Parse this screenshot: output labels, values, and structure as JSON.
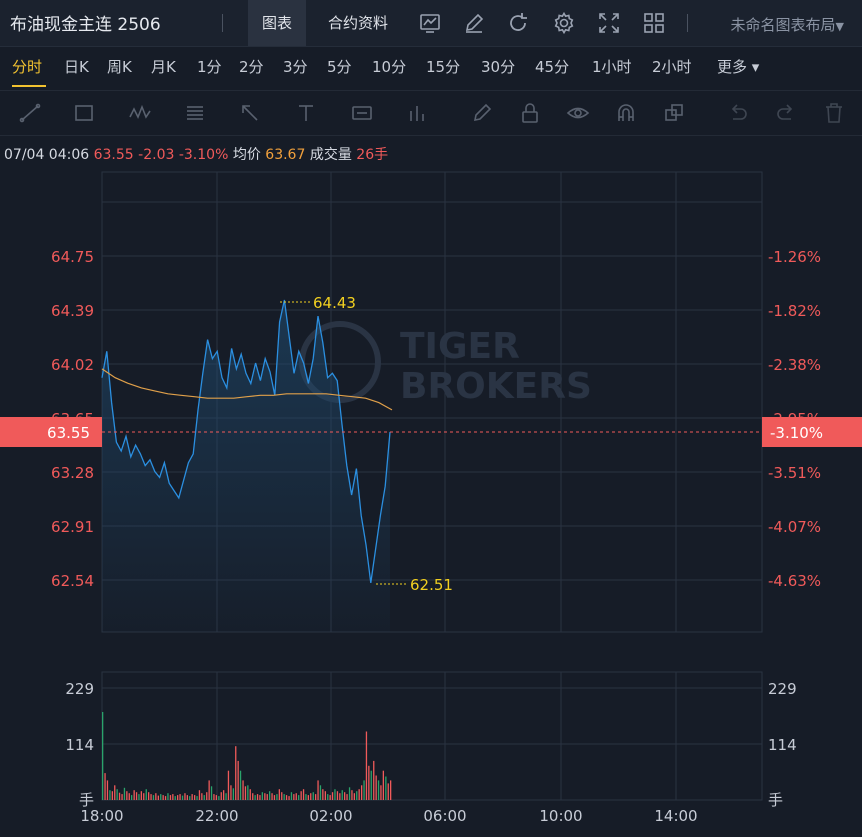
{
  "header": {
    "title": "布油现金主连 2506",
    "tabs": [
      {
        "label": "图表"
      },
      {
        "label": "合约资料"
      }
    ],
    "layout_label": "未命名图表布局"
  },
  "periods": [
    "分时",
    "日K",
    "周K",
    "月K",
    "1分",
    "2分",
    "3分",
    "5分",
    "10分",
    "15分",
    "30分",
    "45分",
    "1小时",
    "2小时",
    "更多"
  ],
  "info": {
    "time": "07/04 04:06",
    "price": "63.55",
    "change": "-2.03",
    "change_pct": "-3.10%",
    "avg_label": "均价",
    "avg": "63.67",
    "vol_label": "成交量",
    "vol": "26手"
  },
  "colors": {
    "up": "#f05a5a",
    "price_line": "#2b8fe0",
    "avg_line": "#e0a04a",
    "marker": "#f2d020",
    "volume_down": "#2aa36b"
  },
  "watermark": [
    "TIGER",
    "BROKERS"
  ],
  "chart_data": {
    "type": "line",
    "price_ticks": [
      "64.75",
      "64.39",
      "64.02",
      "63.65",
      "63.28",
      "62.91",
      "62.54"
    ],
    "pct_ticks": [
      "-1.26%",
      "-1.82%",
      "-2.38%",
      "-2.95%",
      "-3.51%",
      "-4.07%",
      "-4.63%"
    ],
    "current_price": "63.55",
    "current_pct": "-3.10%",
    "high_label": "64.43",
    "low_label": "62.51",
    "vol_ticks": [
      "229",
      "114"
    ],
    "vol_unit": "手",
    "x_ticks": [
      "18:00",
      "22:00",
      "02:00",
      "06:00",
      "10:00",
      "14:00"
    ],
    "price_series": [
      63.92,
      64.1,
      63.75,
      63.48,
      63.42,
      63.52,
      63.38,
      63.46,
      63.4,
      63.32,
      63.36,
      63.28,
      63.24,
      63.34,
      63.2,
      63.15,
      63.1,
      63.22,
      63.34,
      63.4,
      63.7,
      63.95,
      64.18,
      64.05,
      64.1,
      63.92,
      63.85,
      64.12,
      63.98,
      64.08,
      63.95,
      63.88,
      64.02,
      63.9,
      64.05,
      63.96,
      63.8,
      64.3,
      64.45,
      64.2,
      63.95,
      64.1,
      64.02,
      63.88,
      64.05,
      64.34,
      64.16,
      63.92,
      63.95,
      63.9,
      63.6,
      63.32,
      63.12,
      63.3,
      62.98,
      62.78,
      62.52,
      62.75,
      62.98,
      63.18,
      63.55
    ],
    "avg_series": [
      63.98,
      63.92,
      63.88,
      63.85,
      63.83,
      63.81,
      63.8,
      63.79,
      63.78,
      63.78,
      63.78,
      63.79,
      63.8,
      63.8,
      63.81,
      63.81,
      63.81,
      63.81,
      63.8,
      63.79,
      63.78,
      63.75,
      63.7
    ],
    "volume_series": [
      180,
      55,
      40,
      20,
      18,
      30,
      22,
      15,
      12,
      25,
      18,
      14,
      10,
      20,
      16,
      12,
      18,
      14,
      22,
      16,
      12,
      10,
      14,
      9,
      12,
      10,
      8,
      14,
      10,
      12,
      8,
      10,
      12,
      9,
      14,
      10,
      8,
      12,
      10,
      8,
      20,
      14,
      10,
      16,
      40,
      28,
      12,
      10,
      8,
      16,
      20,
      14,
      60,
      30,
      24,
      110,
      80,
      60,
      40,
      28,
      30,
      22,
      14,
      10,
      12,
      10,
      16,
      14,
      12,
      18,
      14,
      10,
      12,
      22,
      16,
      12,
      10,
      8,
      16,
      12,
      14,
      10,
      18,
      22,
      12,
      10,
      14,
      16,
      12,
      40,
      30,
      22,
      18,
      12,
      10,
      16,
      22,
      18,
      14,
      20,
      16,
      12,
      26,
      20,
      14,
      18,
      22,
      30,
      40,
      140,
      70,
      60,
      80,
      50,
      40,
      30,
      60,
      48,
      34,
      40
    ]
  }
}
